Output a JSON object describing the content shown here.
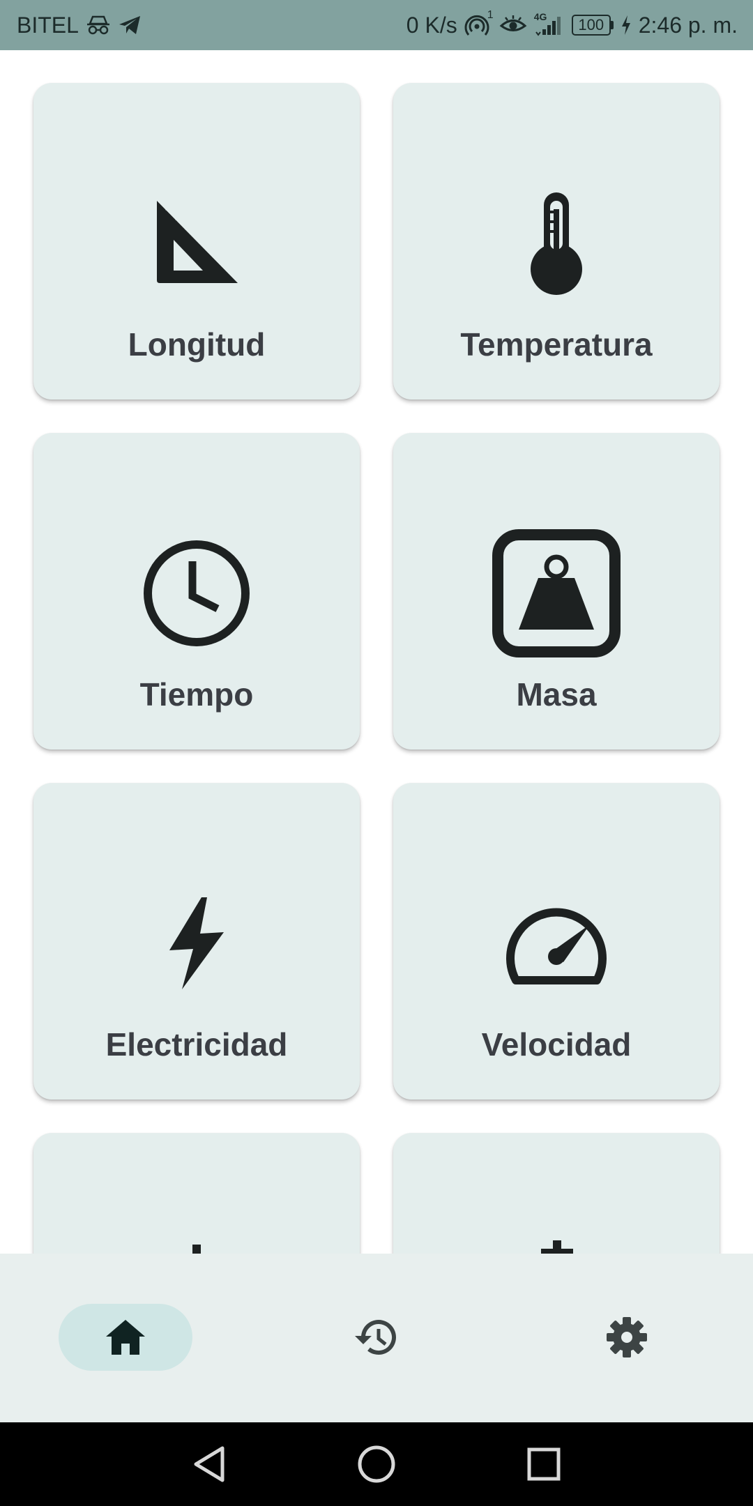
{
  "status_bar": {
    "carrier": "BITEL",
    "speed": "0 K/s",
    "hotspot_count": "1",
    "network": "4G",
    "battery": "100",
    "time": "2:46 p. m.",
    "icons": [
      "incognito-icon",
      "telegram-icon",
      "hotspot-icon",
      "eye-icon",
      "signal-icon",
      "battery-icon",
      "charging-icon"
    ]
  },
  "categories": [
    {
      "label": "Longitud",
      "icon": "ruler-triangle-icon"
    },
    {
      "label": "Temperatura",
      "icon": "thermometer-icon"
    },
    {
      "label": "Tiempo",
      "icon": "clock-icon"
    },
    {
      "label": "Masa",
      "icon": "weight-icon"
    },
    {
      "label": "Electricidad",
      "icon": "bolt-icon"
    },
    {
      "label": "Velocidad",
      "icon": "speedometer-icon"
    }
  ],
  "bottom_nav": {
    "items": [
      {
        "name": "home",
        "icon": "home-icon",
        "active": true
      },
      {
        "name": "history",
        "icon": "history-icon",
        "active": false
      },
      {
        "name": "settings",
        "icon": "gear-icon",
        "active": false
      }
    ]
  },
  "colors": {
    "status_bar": "#82a29f",
    "card_bg": "#e4eeed",
    "label": "#3b3e44",
    "icon": "#1d2121",
    "nav_bg": "#e8efee",
    "nav_active_pill": "#cfe6e5"
  }
}
